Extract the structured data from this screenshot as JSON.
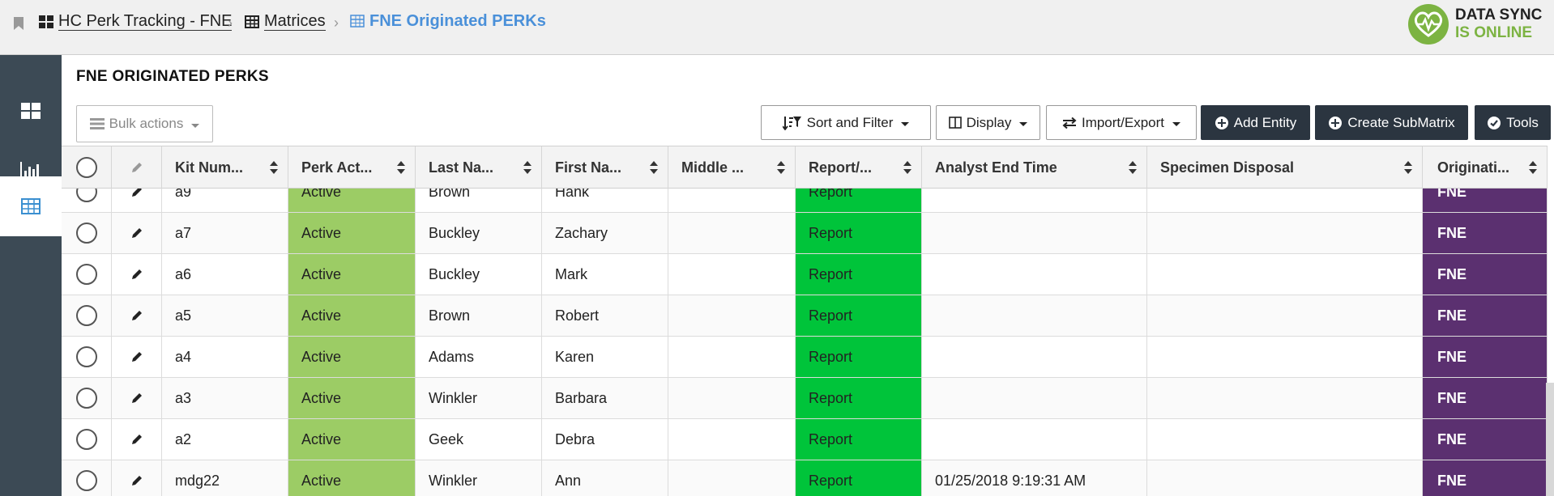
{
  "breadcrumb": {
    "items": [
      {
        "label": "HC Perk Tracking - FNE",
        "icon": "dashboard-icon"
      },
      {
        "label": "Matrices",
        "icon": "table-icon"
      },
      {
        "label": "FNE Originated PERKs",
        "icon": "table-icon"
      }
    ],
    "separator": "›"
  },
  "sync": {
    "line1": "DATA SYNC",
    "line2": "IS ONLINE",
    "icon": "heartbeat-icon",
    "color": "#7cb342"
  },
  "sidebar": {
    "items": [
      {
        "name": "dashboard",
        "icon": "dashboard-icon"
      },
      {
        "name": "charts",
        "icon": "bar-chart-icon"
      },
      {
        "name": "matrices",
        "icon": "table-icon",
        "active": true
      }
    ]
  },
  "page": {
    "title": "FNE ORIGINATED PERKS"
  },
  "toolbar": {
    "bulk_actions": "Bulk actions",
    "sort_filter": "Sort and Filter",
    "display": "Display",
    "import_export": "Import/Export",
    "add_entity": "Add Entity",
    "create_submatrix": "Create SubMatrix",
    "tools": "Tools"
  },
  "table": {
    "columns": [
      "Kit Num...",
      "Perk Act...",
      "Last Na...",
      "First Na...",
      "Middle ...",
      "Report/...",
      "Analyst End Time",
      "Specimen Disposal",
      "Originati..."
    ],
    "rows": [
      {
        "kit": "a9",
        "perk": "Active",
        "last": "Brown",
        "first": "Hank",
        "middle": "",
        "report": "Report",
        "end_time": "",
        "disposal": "",
        "orig": "FNE"
      },
      {
        "kit": "a7",
        "perk": "Active",
        "last": "Buckley",
        "first": "Zachary",
        "middle": "",
        "report": "Report",
        "end_time": "",
        "disposal": "",
        "orig": "FNE"
      },
      {
        "kit": "a6",
        "perk": "Active",
        "last": "Buckley",
        "first": "Mark",
        "middle": "",
        "report": "Report",
        "end_time": "",
        "disposal": "",
        "orig": "FNE"
      },
      {
        "kit": "a5",
        "perk": "Active",
        "last": "Brown",
        "first": "Robert",
        "middle": "",
        "report": "Report",
        "end_time": "",
        "disposal": "",
        "orig": "FNE"
      },
      {
        "kit": "a4",
        "perk": "Active",
        "last": "Adams",
        "first": "Karen",
        "middle": "",
        "report": "Report",
        "end_time": "",
        "disposal": "",
        "orig": "FNE"
      },
      {
        "kit": "a3",
        "perk": "Active",
        "last": "Winkler",
        "first": "Barbara",
        "middle": "",
        "report": "Report",
        "end_time": "",
        "disposal": "",
        "orig": "FNE"
      },
      {
        "kit": "a2",
        "perk": "Active",
        "last": "Geek",
        "first": "Debra",
        "middle": "",
        "report": "Report",
        "end_time": "",
        "disposal": "",
        "orig": "FNE"
      },
      {
        "kit": "mdg22",
        "perk": "Active",
        "last": "Winkler",
        "first": "Ann",
        "middle": "",
        "report": "Report",
        "end_time": "01/25/2018 9:19:31 AM",
        "disposal": "",
        "orig": "FNE"
      }
    ]
  },
  "colors": {
    "perk_active": "#9ccc65",
    "report": "#00c43a",
    "originating": "#5b3070",
    "sidebar": "#3c4a55",
    "accent": "#4a90d9"
  }
}
